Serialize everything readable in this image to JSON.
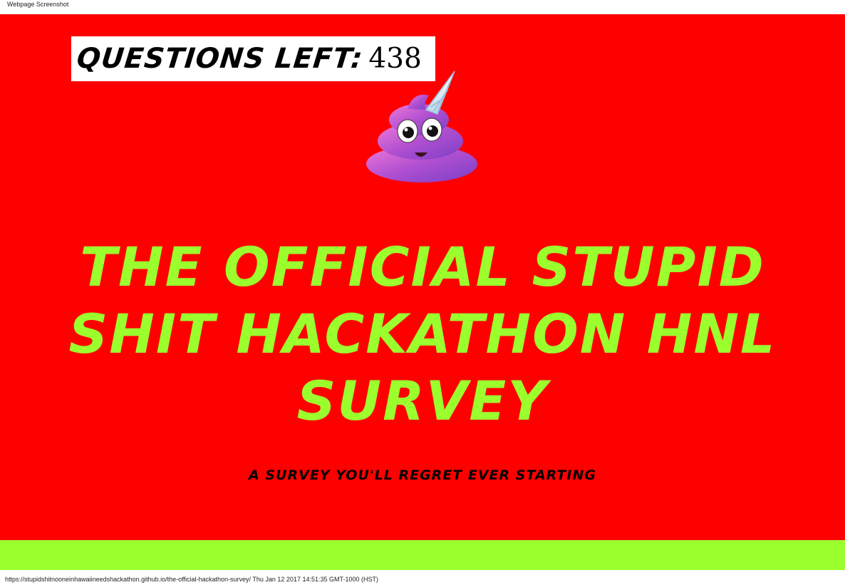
{
  "print": {
    "header": "Webpage Screenshot",
    "footer": "https://stupidshitnooneinhawaiineedshackathon.github.io/the-official-hackathon-survey/ Thu Jan 12 2017 14:51:35 GMT-1000 (HST)"
  },
  "counter": {
    "label": "QUESTIONS LEFT:",
    "value": "438"
  },
  "hero": {
    "mascot_icon": "unicorn-poop-emoji-icon",
    "title": "THE OFFICIAL STUPID SHIT HACKATHON HNL SURVEY",
    "subtitle": "A SURVEY YOU'LL REGRET EVER STARTING"
  },
  "colors": {
    "background_red": "#ff0000",
    "accent_green": "#9bff2e",
    "counter_bg": "#ffffff",
    "text_dark": "#000000"
  }
}
